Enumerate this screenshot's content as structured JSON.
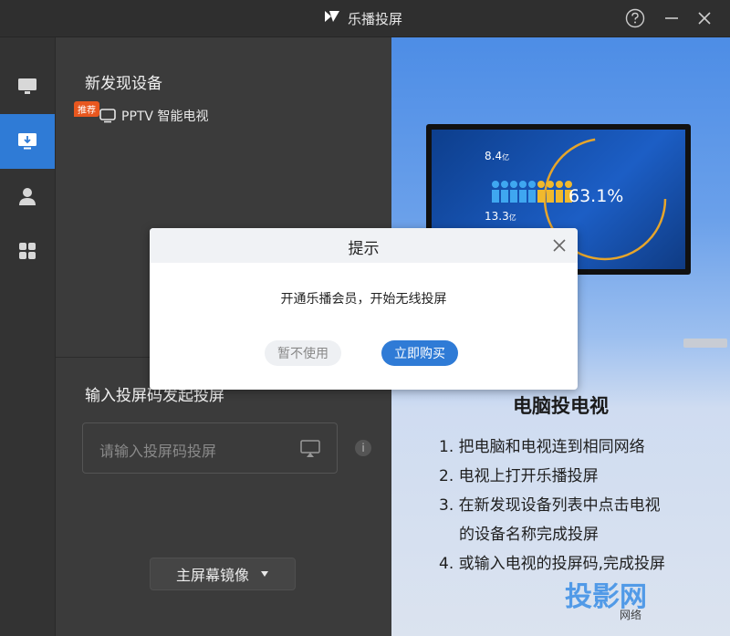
{
  "app": {
    "title": "乐播投屏"
  },
  "left": {
    "discover_title": "新发现设备",
    "device": {
      "badge": "推荐",
      "name": "PPTV 智能电视"
    },
    "code_title": "输入投屏码发起投屏",
    "code_input_placeholder": "请输入投屏码投屏",
    "info_symbol": "i",
    "mirror_button": "主屏幕镜像"
  },
  "guide": {
    "title": "电脑投电视",
    "steps": [
      "1. 把电脑和电视连到相同网络",
      "2. 电视上打开乐播投屏",
      "3. 在新发现设备列表中点击电视",
      "的设备名称完成投屏",
      "4. 或输入电视的投屏码,完成投屏"
    ],
    "tv_stats": {
      "a": "8.4",
      "a_unit": "亿",
      "b": "63.1%",
      "c": "13.3",
      "c_unit": "亿"
    }
  },
  "watermark": {
    "text": "投影网",
    "sub": "网络"
  },
  "dialog": {
    "title": "提示",
    "message": "开通乐播会员，开始无线投屏",
    "cancel": "暂不使用",
    "confirm": "立即购买"
  },
  "colors": {
    "accent": "#2f7bd6",
    "badge": "#e8571f"
  }
}
